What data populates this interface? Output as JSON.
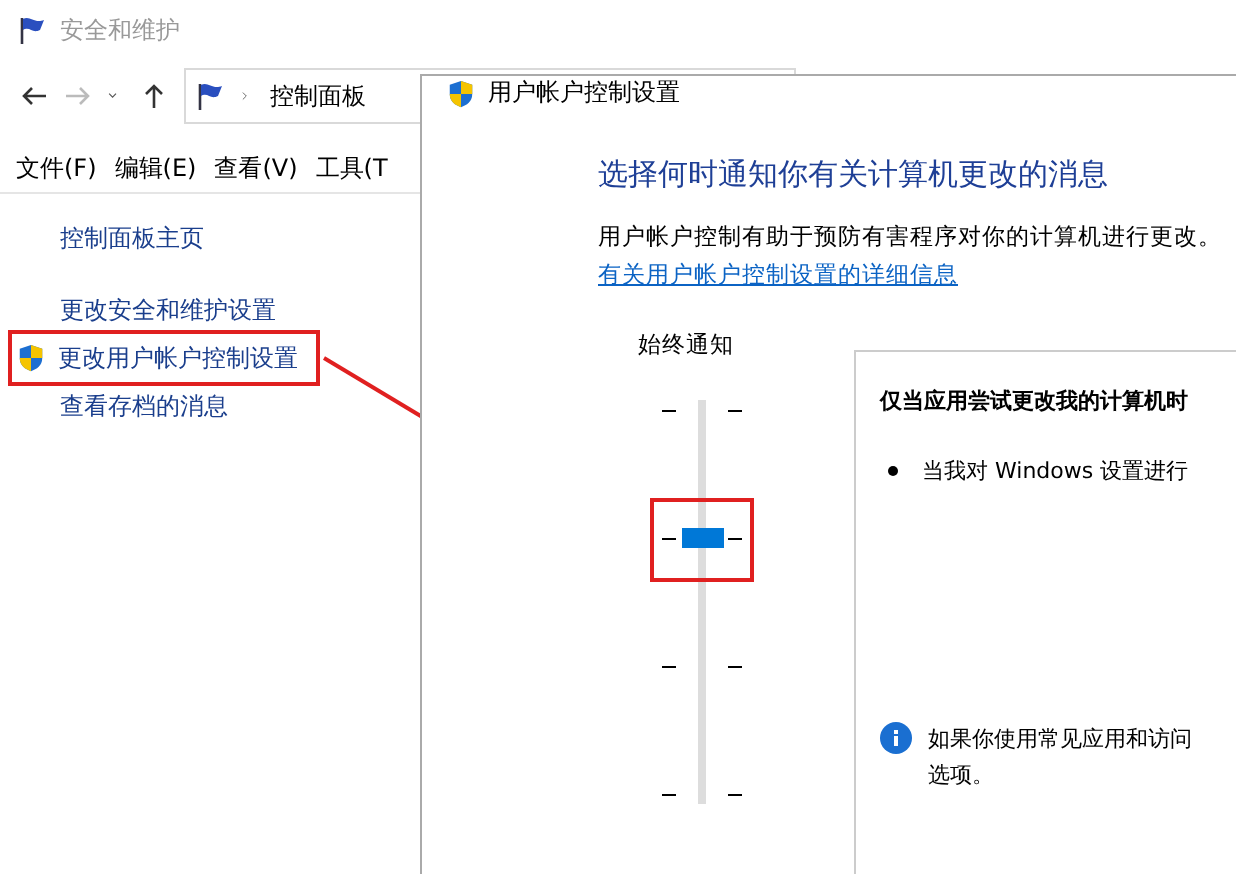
{
  "back_window": {
    "title": "安全和维护",
    "address": "控制面板",
    "menu": [
      "文件(F)",
      "编辑(E)",
      "查看(V)",
      "工具(T"
    ],
    "sidebar": {
      "items": [
        {
          "label": "控制面板主页",
          "shield": false,
          "highlighted": false
        },
        {
          "label": "更改安全和维护设置",
          "shield": false,
          "highlighted": false
        },
        {
          "label": "更改用户帐户控制设置",
          "shield": true,
          "highlighted": true
        },
        {
          "label": "查看存档的消息",
          "shield": false,
          "highlighted": false
        }
      ]
    }
  },
  "dialog": {
    "title": "用户帐户控制设置",
    "heading": "选择何时通知你有关计算机更改的消息",
    "description": "用户帐户控制有助于预防有害程序对你的计算机进行更改。",
    "link": "有关用户帐户控制设置的详细信息",
    "slider": {
      "top_label": "始终通知",
      "level": 0.667,
      "highlighted": true
    },
    "panel": {
      "title": "仅当应用尝试更改我的计算机时",
      "bullets": [
        "当我对 Windows 设置进行"
      ],
      "info": [
        "如果你使用常见应用和访问",
        "选项。"
      ]
    }
  }
}
